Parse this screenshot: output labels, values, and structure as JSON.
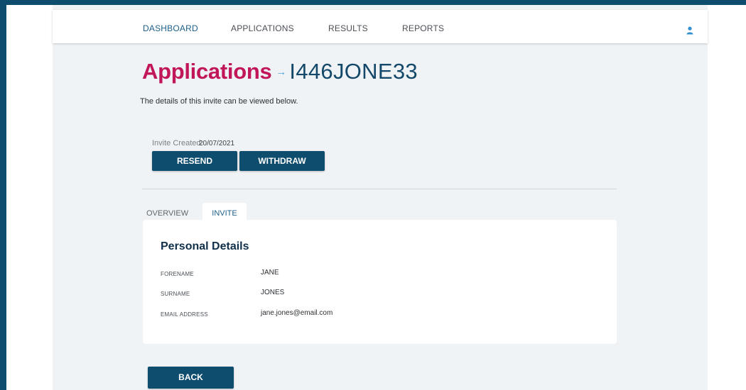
{
  "nav": {
    "items": [
      "DASHBOARD",
      "APPLICATIONS",
      "RESULTS",
      "REPORTS"
    ],
    "active": "DASHBOARD",
    "user_icon": "user-icon"
  },
  "header": {
    "title": "Applications",
    "arrow": "→",
    "invite_id": "I446JONE33",
    "subtitle": "The details of this invite can be viewed below."
  },
  "invite": {
    "created_label": "Invite Created:",
    "created_date": "20/07/2021"
  },
  "actions": {
    "resend_label": "RESEND",
    "withdraw_label": "WITHDRAW",
    "back_label": "BACK"
  },
  "tabs": {
    "items": [
      "OVERVIEW",
      "INVITE"
    ],
    "active": "INVITE"
  },
  "details": {
    "title": "Personal Details",
    "fields": [
      {
        "label": "FORENAME",
        "value": "JANE"
      },
      {
        "label": "SURNAME",
        "value": "JONES"
      },
      {
        "label": "EMAIL ADDRESS",
        "value": "jane.jones@email.com"
      }
    ]
  },
  "colors": {
    "frame": "#0e4d6e",
    "primary_button": "#0e4d6e",
    "title_accent": "#c1175a",
    "title_id": "#13486a",
    "arrow": "#4fa3d8",
    "nav_active": "#1d5f8a",
    "background": "#f0f3f5"
  }
}
